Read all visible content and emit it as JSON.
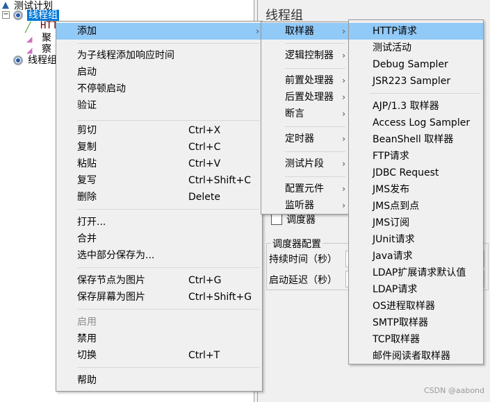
{
  "tree": {
    "items": [
      {
        "label": "测试计划",
        "icon": "flask-icon"
      },
      {
        "label": "线程组",
        "icon": "gear-icon",
        "selected": true
      },
      {
        "label": "HTTP",
        "icon": "pipette-icon"
      },
      {
        "label": "聚",
        "icon": "chart-icon"
      },
      {
        "label": "察",
        "icon": "chart-icon"
      },
      {
        "label": "线程组",
        "icon": "gear-icon"
      }
    ]
  },
  "panel": {
    "title": "线程组",
    "scheduler_checkbox": "调度器",
    "scheduler_group": "调度器配置",
    "duration_label": "持续时间（秒）",
    "delay_label": "启动延迟（秒）"
  },
  "context_menu": {
    "items": [
      {
        "label": "添加",
        "submenu": true
      },
      {
        "label": "为子线程添加响应时间"
      },
      {
        "label": "启动"
      },
      {
        "label": "不停顿启动"
      },
      {
        "label": "验证"
      },
      {
        "label": "剪切",
        "shortcut": "Ctrl+X"
      },
      {
        "label": "复制",
        "shortcut": "Ctrl+C"
      },
      {
        "label": "粘贴",
        "shortcut": "Ctrl+V"
      },
      {
        "label": "复写",
        "shortcut": "Ctrl+Shift+C"
      },
      {
        "label": "删除",
        "shortcut": "Delete"
      },
      {
        "label": "打开..."
      },
      {
        "label": "合并"
      },
      {
        "label": "选中部分保存为..."
      },
      {
        "label": "保存节点为图片",
        "shortcut": "Ctrl+G"
      },
      {
        "label": "保存屏幕为图片",
        "shortcut": "Ctrl+Shift+G"
      },
      {
        "label": "启用",
        "disabled": true
      },
      {
        "label": "禁用"
      },
      {
        "label": "切换",
        "shortcut": "Ctrl+T"
      },
      {
        "label": "帮助"
      }
    ]
  },
  "add_submenu": {
    "items": [
      {
        "label": "取样器"
      },
      {
        "label": "逻辑控制器"
      },
      {
        "label": "前置处理器"
      },
      {
        "label": "后置处理器"
      },
      {
        "label": "断言"
      },
      {
        "label": "定时器"
      },
      {
        "label": "测试片段"
      },
      {
        "label": "配置元件"
      },
      {
        "label": "监听器"
      }
    ]
  },
  "sampler_submenu": {
    "items": [
      {
        "label": "HTTP请求"
      },
      {
        "label": "测试活动"
      },
      {
        "label": "Debug Sampler"
      },
      {
        "label": "JSR223 Sampler"
      },
      {
        "label": "AJP/1.3 取样器"
      },
      {
        "label": "Access Log Sampler"
      },
      {
        "label": "BeanShell 取样器"
      },
      {
        "label": "FTP请求"
      },
      {
        "label": "JDBC Request"
      },
      {
        "label": "JMS发布"
      },
      {
        "label": "JMS点到点"
      },
      {
        "label": "JMS订阅"
      },
      {
        "label": "JUnit请求"
      },
      {
        "label": "Java请求"
      },
      {
        "label": "LDAP扩展请求默认值"
      },
      {
        "label": "LDAP请求"
      },
      {
        "label": "OS进程取样器"
      },
      {
        "label": "SMTP取样器"
      },
      {
        "label": "TCP取样器"
      },
      {
        "label": "邮件阅读者取样器"
      }
    ]
  },
  "watermark": "CSDN @aabond",
  "colors": {
    "highlight": "#91c9f7",
    "selection": "#0078d7"
  }
}
